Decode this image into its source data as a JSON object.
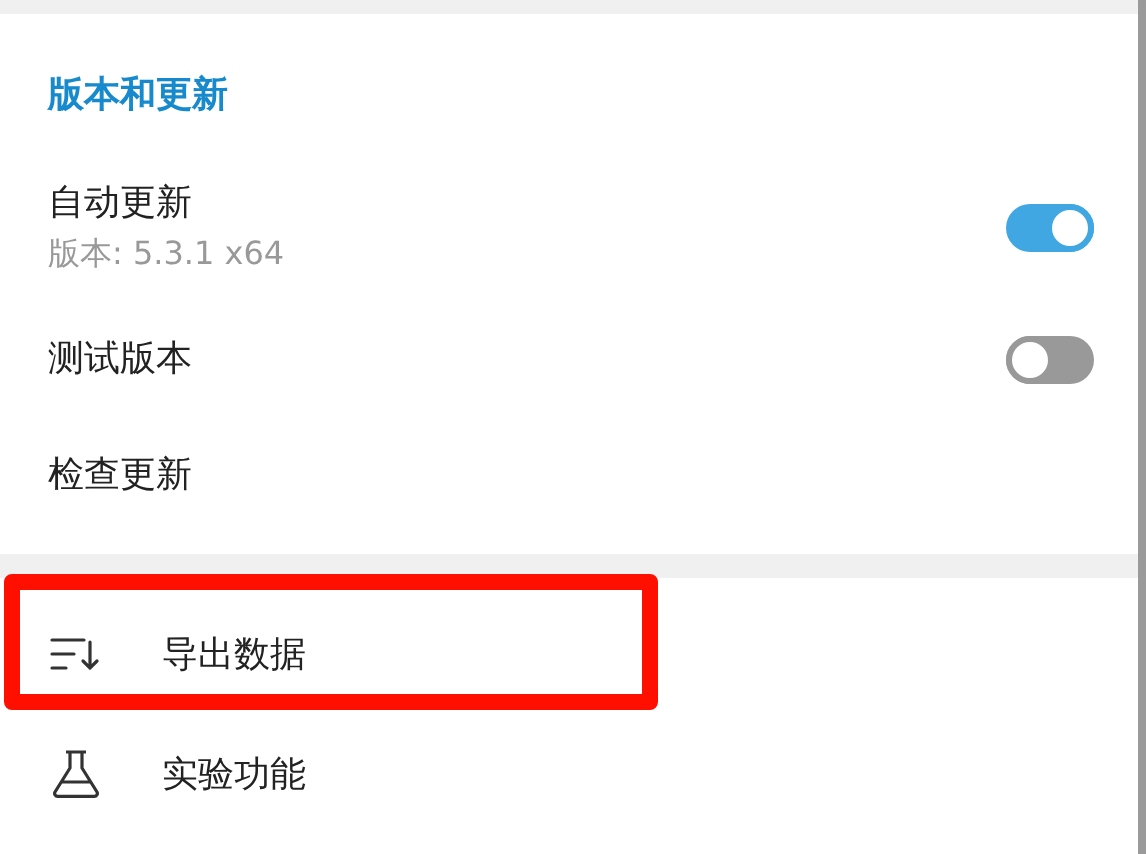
{
  "section": {
    "title": "版本和更新"
  },
  "settings": [
    {
      "kind": "toggle",
      "label": "自动更新",
      "sublabel": "版本: 5.3.1 x64",
      "on": true
    },
    {
      "kind": "toggle",
      "label": "测试版本",
      "on": false
    },
    {
      "kind": "action",
      "label": "检查更新"
    }
  ],
  "menu": [
    {
      "kind": "export",
      "label": "导出数据",
      "highlighted": true
    },
    {
      "kind": "flask",
      "label": "实验功能",
      "highlighted": false
    }
  ]
}
